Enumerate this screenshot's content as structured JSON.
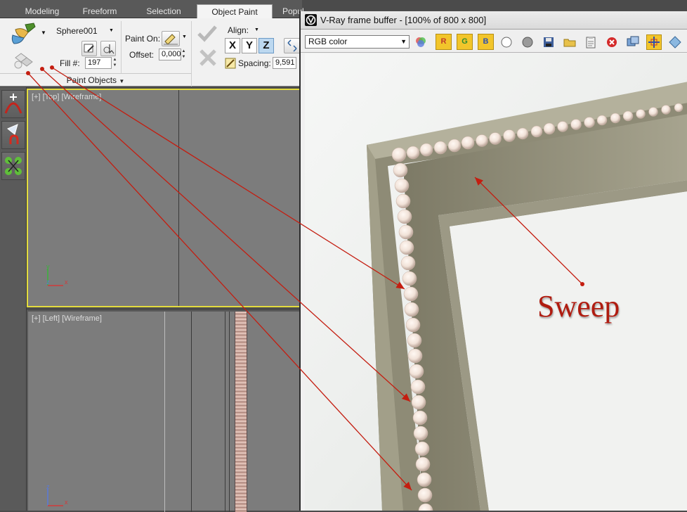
{
  "ribbon_tabs": [
    "Modeling",
    "Freeform",
    "Selection",
    "Object Paint",
    "Popul"
  ],
  "active_tab": "Object Paint",
  "paint_objects": {
    "object_name": "Sphere001",
    "fill_label": "Fill #:",
    "fill_value": "197",
    "paint_on_label": "Paint On:",
    "offset_label": "Offset:",
    "offset_value": "0,000",
    "panel_title": "Paint Objects"
  },
  "align": {
    "label": "Align:",
    "axes": [
      "X",
      "Y",
      "Z"
    ],
    "active_axis": "Z",
    "spacing_label": "Spacing:",
    "spacing_value": "9,591"
  },
  "viewports": {
    "top_label": "[+] [Top] [Wireframe]",
    "left_label": "[+] [Left] [Wireframe]",
    "top_axes": [
      "y",
      "z",
      "x"
    ],
    "left_axes": [
      "z",
      "x"
    ]
  },
  "vfb": {
    "title": "V-Ray frame buffer - [100% of 800 x 800]",
    "channel": "RGB color",
    "channel_buttons": [
      "R",
      "G",
      "B"
    ]
  },
  "annotation": {
    "text": "Sweep",
    "color": "#b01c10"
  }
}
